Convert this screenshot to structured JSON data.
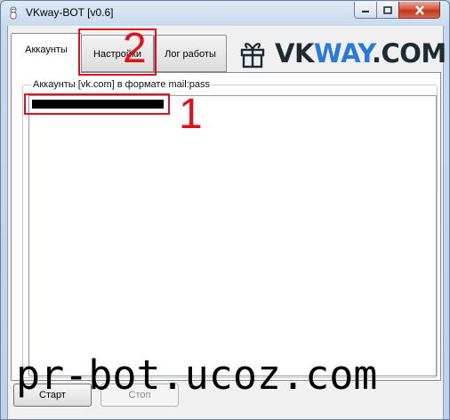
{
  "window": {
    "title": "VKway-BOT [v0.6]",
    "minimize_glyph": "—",
    "maximize_glyph": "▢",
    "close_glyph": "✕"
  },
  "tabs": [
    {
      "label": "Аккаунты",
      "active": true
    },
    {
      "label": "Настройки",
      "active": false
    },
    {
      "label": "Лог работы",
      "active": false
    }
  ],
  "logo": {
    "vk": "VK",
    "way": "WAY",
    "com": ".COM",
    "icon": "gift-icon"
  },
  "accounts": {
    "group_label": "Аккаунты [vk.com] в формате mail:pass"
  },
  "annotations": {
    "one": "1",
    "two": "2"
  },
  "buttons": {
    "start": "Старт",
    "stop": "Стоп"
  },
  "watermark": "pr-bot.ucoz.com",
  "colors": {
    "annotation": "#e0111b",
    "logo_accent": "#2a7bd5"
  }
}
